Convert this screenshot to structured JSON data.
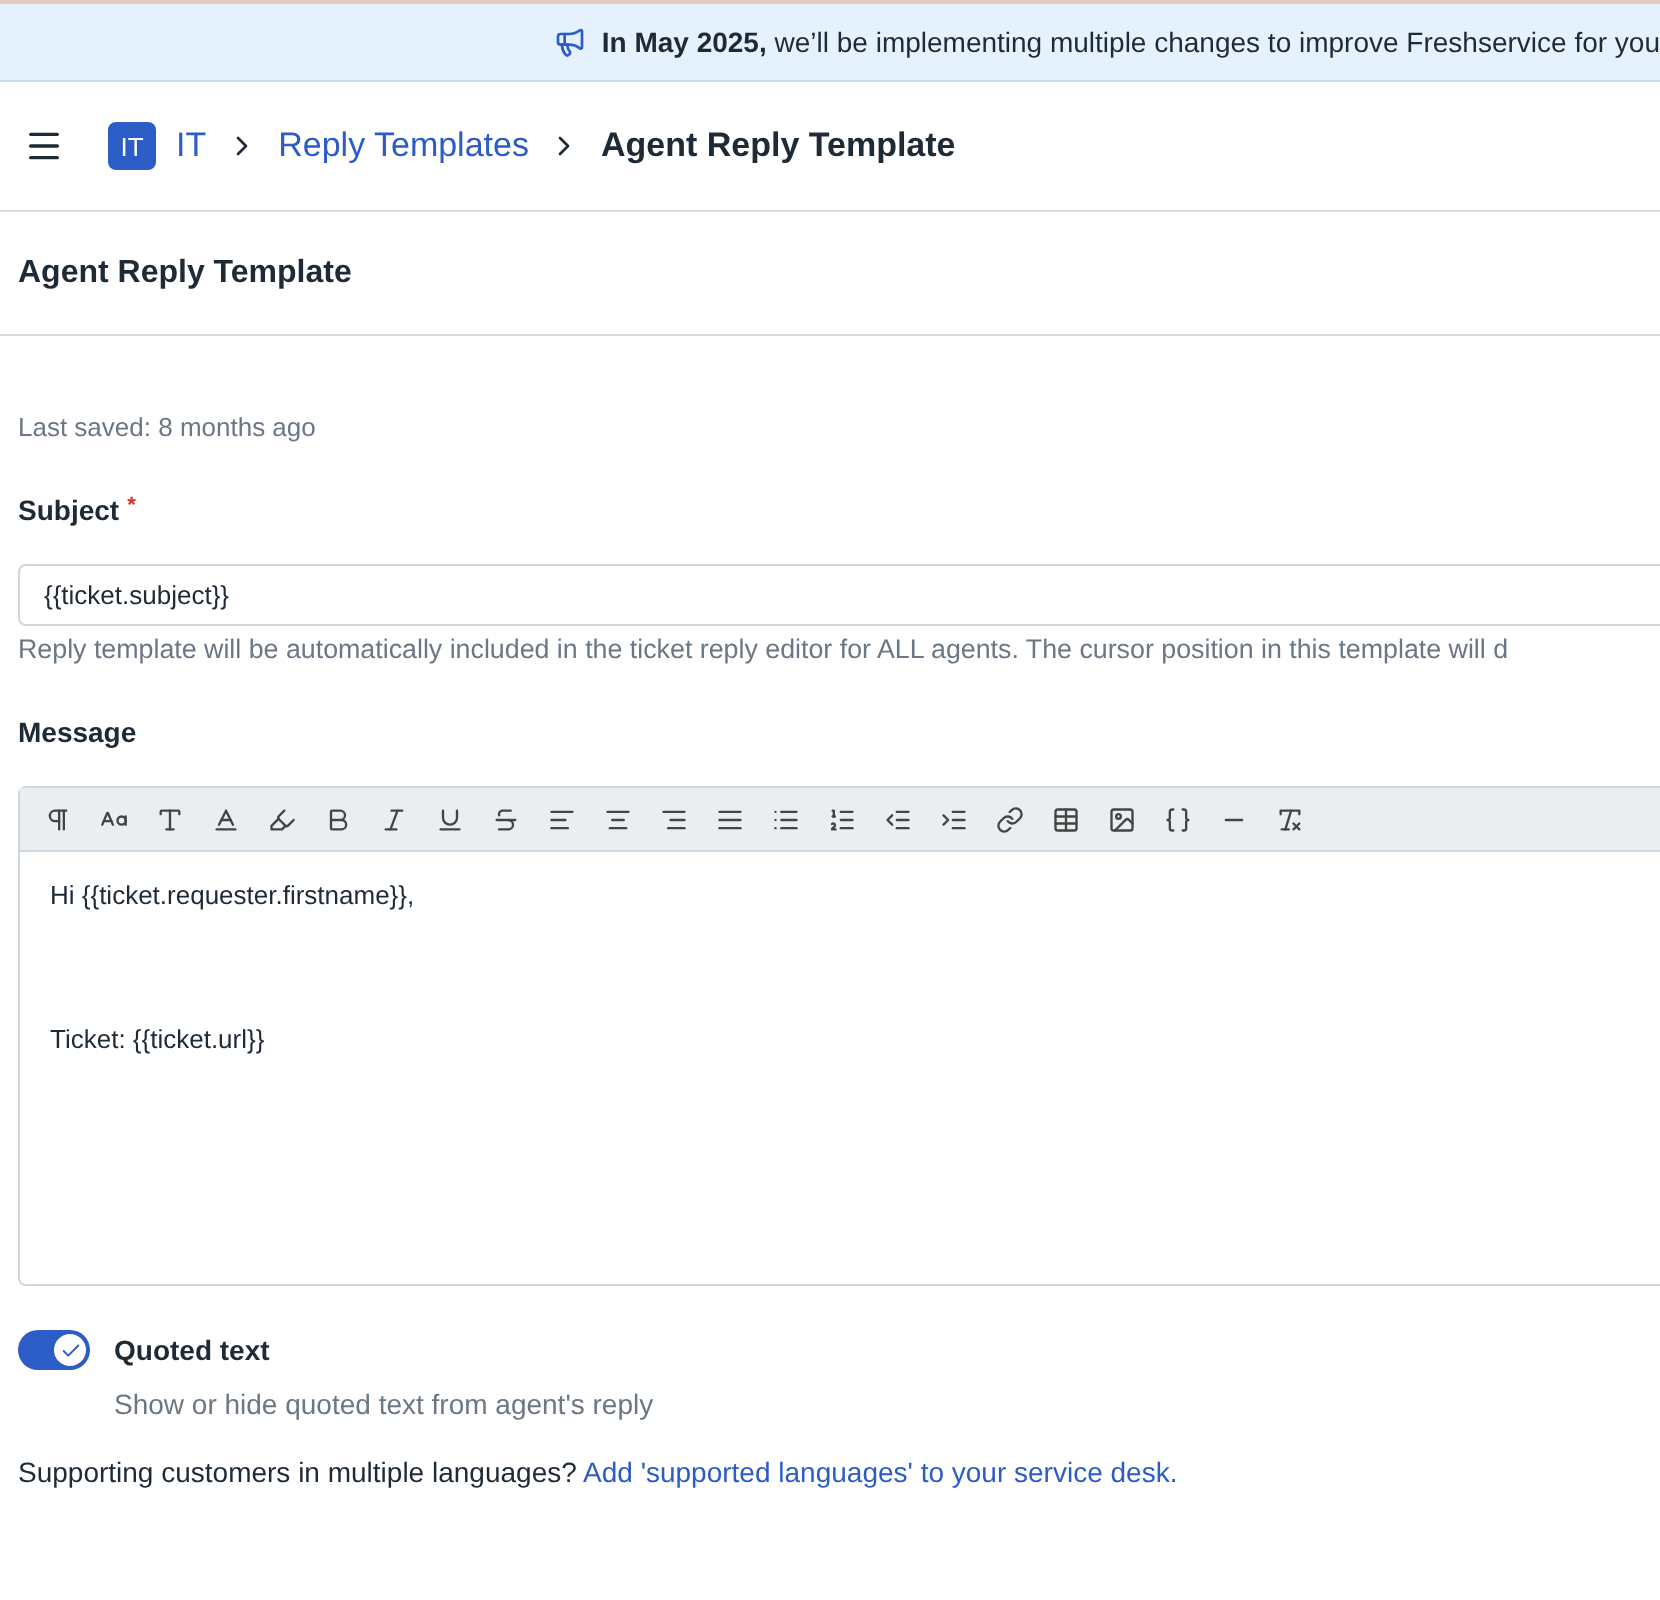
{
  "banner": {
    "text": "**In May 2025,** we’ll be implementing multiple changes to improve Freshservice for you"
  },
  "breadcrumb": {
    "badge": "IT",
    "items": [
      {
        "label": "IT",
        "kind": "link"
      },
      {
        "label": "Reply Templates",
        "kind": "link"
      },
      {
        "label": "Agent Reply Template",
        "kind": "current"
      }
    ]
  },
  "page_title": "Agent Reply Template",
  "last_saved": "Last saved: 8 months ago",
  "subject": {
    "label": "Subject",
    "required": true,
    "required_mark": "*",
    "value": "{{ticket.subject}}",
    "hint": "Reply template will be automatically included in the ticket reply editor for ALL agents. The cursor position in this template will d"
  },
  "message": {
    "label": "Message",
    "toolbar": [
      {
        "kind": "paragraph"
      },
      {
        "kind": "case"
      },
      {
        "kind": "size"
      },
      {
        "kind": "color"
      },
      {
        "kind": "highlight"
      },
      {
        "kind": "bold"
      },
      {
        "kind": "italic"
      },
      {
        "kind": "underline"
      },
      {
        "kind": "strike"
      },
      {
        "kind": "left"
      },
      {
        "kind": "center"
      },
      {
        "kind": "right"
      },
      {
        "kind": "justify"
      },
      {
        "kind": "bullets"
      },
      {
        "kind": "numbers"
      },
      {
        "kind": "outdent"
      },
      {
        "kind": "indent"
      },
      {
        "kind": "link"
      },
      {
        "kind": "table"
      },
      {
        "kind": "image"
      },
      {
        "kind": "code"
      },
      {
        "kind": "rule"
      },
      {
        "kind": "clear"
      }
    ],
    "lines": [
      {
        "kind": "text",
        "text": "Hi {{ticket.requester.firstname}},"
      },
      {
        "kind": "blank"
      },
      {
        "kind": "blank"
      },
      {
        "kind": "text",
        "text": "Ticket: {{ticket.url}}"
      }
    ]
  },
  "quoted_text": {
    "label": "Quoted text",
    "on": true,
    "description": "Show or hide quoted text from agent's reply"
  },
  "footer": {
    "text": "Supporting customers in multiple languages?",
    "link": "Add 'supported languages' to your service desk."
  }
}
